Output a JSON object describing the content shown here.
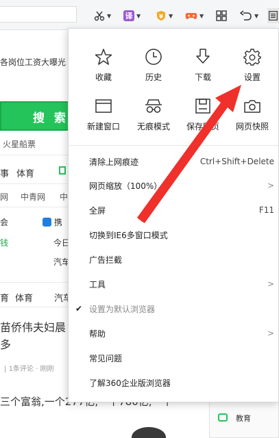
{
  "toolbar": {
    "scissors_icon": "scissors-icon",
    "translate_badge": "译",
    "coupon_badge": "¥",
    "game_icon": "gamepad-icon",
    "apps_icon": "grid-icon",
    "undo_icon": "undo-icon",
    "menu_icon": "hamburger-icon",
    "colors": {
      "translate": "#9b59d0",
      "coupon": "#f5a623",
      "game": "#f26b3a"
    }
  },
  "background_page": {
    "headline_frag": "各岗位工资大曝光",
    "search_label": "搜 索",
    "hot_text": "火星船票",
    "tabs_row1": [
      "事",
      "体育"
    ],
    "links_row": [
      "网",
      "中青网",
      "中"
    ],
    "side_frag1": "会",
    "side_frag2": "钱",
    "side_frag3": "携",
    "side_frag4": "今日",
    "side_frag5": "汽车",
    "tabs_row2": [
      "育",
      "体育",
      "汽车"
    ],
    "news_title_1": "苗侨伟夫妇晨",
    "news_title_2": "多",
    "news_meta": "1条评论 · 刚刚",
    "news_body": "三个富翁,一个277亿,一个780亿,一个",
    "bottom_widget_label": "教育"
  },
  "menu": {
    "grid": [
      {
        "icon": "star-icon",
        "label": "收藏"
      },
      {
        "icon": "clock-icon",
        "label": "历史"
      },
      {
        "icon": "download-icon",
        "label": "下载"
      },
      {
        "icon": "gear-icon",
        "label": "设置"
      },
      {
        "icon": "new-window-icon",
        "label": "新建窗口"
      },
      {
        "icon": "glasses-icon",
        "label": "无痕模式"
      },
      {
        "icon": "save-page-icon",
        "label": "保存网页"
      },
      {
        "icon": "camera-icon",
        "label": "网页快照"
      }
    ],
    "items": [
      {
        "label": "清除上网痕迹",
        "shortcut": "Ctrl+Shift+Delete"
      },
      {
        "label": "网页缩放（100%）",
        "shortcut": ">"
      },
      {
        "label": "全屏",
        "shortcut": "F11"
      },
      {
        "label": "切换到IE6多窗口模式",
        "shortcut": ""
      },
      {
        "label": "广告拦截",
        "shortcut": ""
      },
      {
        "label": "工具",
        "shortcut": ">"
      },
      {
        "label": "设置为默认浏览器",
        "shortcut": "",
        "checked": "✔"
      },
      {
        "label": "帮助",
        "shortcut": ">"
      },
      {
        "label": "常见问题",
        "shortcut": ""
      },
      {
        "label": "了解360企业版浏览器",
        "shortcut": ""
      }
    ]
  },
  "annotation": {
    "arrow_color": "#f0302a"
  }
}
